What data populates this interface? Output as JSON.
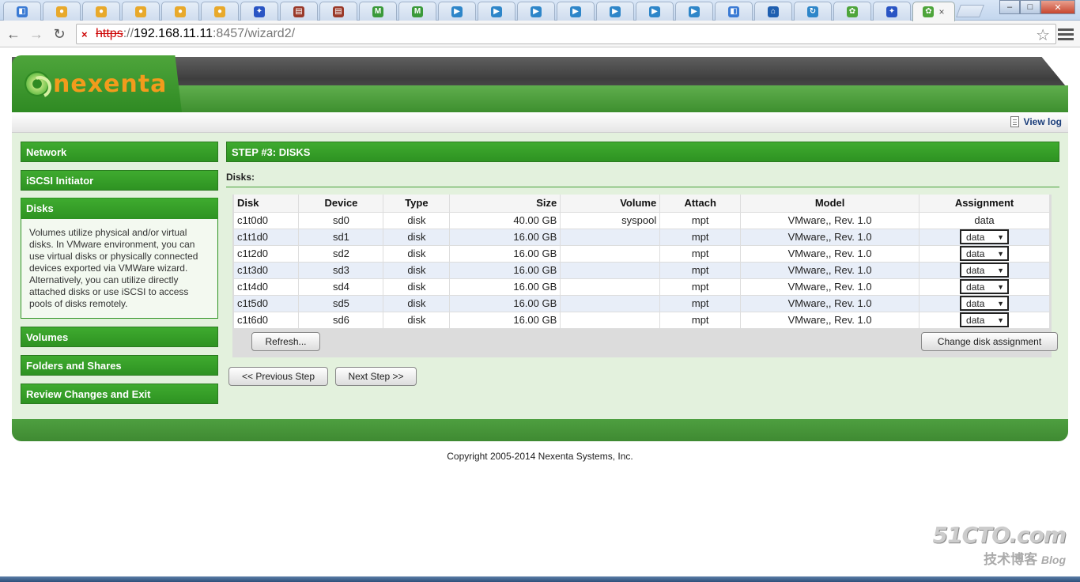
{
  "browser": {
    "tabs": [
      {
        "icon": "finder-icon",
        "color": "#3b7bd4",
        "glyph": "◧"
      },
      {
        "icon": "chat-bubble-icon",
        "color": "#e8a92b",
        "glyph": "●"
      },
      {
        "icon": "chat-bubble-icon",
        "color": "#e8a92b",
        "glyph": "●"
      },
      {
        "icon": "chat-bubble-icon",
        "color": "#e8a92b",
        "glyph": "●"
      },
      {
        "icon": "chat-bubble-icon",
        "color": "#e8a92b",
        "glyph": "●"
      },
      {
        "icon": "chat-bubble-icon",
        "color": "#e8a92b",
        "glyph": "●"
      },
      {
        "icon": "paw-icon",
        "color": "#2a55c4",
        "glyph": "✦"
      },
      {
        "icon": "notebook-icon",
        "color": "#9a3a2a",
        "glyph": "▤"
      },
      {
        "icon": "notebook-icon",
        "color": "#9a3a2a",
        "glyph": "▤"
      },
      {
        "icon": "mx-icon",
        "color": "#3a9a3a",
        "glyph": "M"
      },
      {
        "icon": "mx-icon",
        "color": "#3a9a3a",
        "glyph": "M"
      },
      {
        "icon": "play-circle-icon",
        "color": "#2e86c9",
        "glyph": "▶"
      },
      {
        "icon": "play-circle-icon",
        "color": "#2e86c9",
        "glyph": "▶"
      },
      {
        "icon": "play-circle-icon",
        "color": "#2e86c9",
        "glyph": "▶"
      },
      {
        "icon": "play-circle-icon",
        "color": "#2e86c9",
        "glyph": "▶"
      },
      {
        "icon": "play-circle-icon",
        "color": "#2e86c9",
        "glyph": "▶"
      },
      {
        "icon": "play-circle-icon",
        "color": "#2e86c9",
        "glyph": "▶"
      },
      {
        "icon": "play-circle-icon",
        "color": "#2e86c9",
        "glyph": "▶"
      },
      {
        "icon": "finder-icon",
        "color": "#3b7bd4",
        "glyph": "◧"
      },
      {
        "icon": "home-icon",
        "color": "#1f5fb0",
        "glyph": "⌂"
      },
      {
        "icon": "refresh-app-icon",
        "color": "#2e86c9",
        "glyph": "↻"
      },
      {
        "icon": "nexenta-icon",
        "color": "#4ea53b",
        "glyph": "✿"
      },
      {
        "icon": "paw-icon",
        "color": "#2a55c4",
        "glyph": "✦"
      }
    ],
    "active_tab": {
      "icon": "nexenta-icon",
      "color": "#4ea53b",
      "glyph": "✿",
      "close": "×"
    },
    "window": {
      "minimize": "–",
      "maximize": "□",
      "close": "✕"
    },
    "url": {
      "scheme": "https",
      "sep": "://",
      "host": "192.168.11.11",
      "rest": ":8457/wizard2/"
    }
  },
  "header": {
    "logo_text": "nexenta",
    "view_log": "View log"
  },
  "sidebar": {
    "items": [
      {
        "label": "Network"
      },
      {
        "label": "iSCSI Initiator"
      },
      {
        "label": "Disks"
      },
      {
        "label": "Volumes"
      },
      {
        "label": "Folders and Shares"
      },
      {
        "label": "Review Changes and Exit"
      }
    ],
    "disks_description": "Volumes utilize physical and/or virtual disks. In VMware environment, you can use virtual disks or physically connected devices exported via VMWare wizard. Alternatively, you can utilize directly attached disks or use iSCSI to access pools of disks remotely."
  },
  "main": {
    "step_title": "STEP #3: DISKS",
    "disks_label": "Disks:",
    "columns": [
      "Disk",
      "Device",
      "Type",
      "Size",
      "Volume",
      "Attach",
      "Model",
      "Assignment"
    ],
    "rows": [
      {
        "disk": "c1t0d0",
        "device": "sd0",
        "type": "disk",
        "size": "40.00 GB",
        "volume": "syspool",
        "attach": "mpt",
        "model": "VMware,, Rev. 1.0",
        "assignment": "data",
        "editable": false
      },
      {
        "disk": "c1t1d0",
        "device": "sd1",
        "type": "disk",
        "size": "16.00 GB",
        "volume": "",
        "attach": "mpt",
        "model": "VMware,, Rev. 1.0",
        "assignment": "data",
        "editable": true
      },
      {
        "disk": "c1t2d0",
        "device": "sd2",
        "type": "disk",
        "size": "16.00 GB",
        "volume": "",
        "attach": "mpt",
        "model": "VMware,, Rev. 1.0",
        "assignment": "data",
        "editable": true
      },
      {
        "disk": "c1t3d0",
        "device": "sd3",
        "type": "disk",
        "size": "16.00 GB",
        "volume": "",
        "attach": "mpt",
        "model": "VMware,, Rev. 1.0",
        "assignment": "data",
        "editable": true
      },
      {
        "disk": "c1t4d0",
        "device": "sd4",
        "type": "disk",
        "size": "16.00 GB",
        "volume": "",
        "attach": "mpt",
        "model": "VMware,, Rev. 1.0",
        "assignment": "data",
        "editable": true
      },
      {
        "disk": "c1t5d0",
        "device": "sd5",
        "type": "disk",
        "size": "16.00 GB",
        "volume": "",
        "attach": "mpt",
        "model": "VMware,, Rev. 1.0",
        "assignment": "data",
        "editable": true
      },
      {
        "disk": "c1t6d0",
        "device": "sd6",
        "type": "disk",
        "size": "16.00 GB",
        "volume": "",
        "attach": "mpt",
        "model": "VMware,, Rev. 1.0",
        "assignment": "data",
        "editable": true
      }
    ],
    "refresh_button": "Refresh...",
    "change_assignment_button": "Change disk assignment",
    "prev_button": "<< Previous Step",
    "next_button": "Next Step >>"
  },
  "footer": {
    "copyright": "Copyright 2005-2014 Nexenta Systems, Inc."
  },
  "watermark": {
    "line1": "51CTO.com",
    "line2": "技术博客",
    "line3": "Blog"
  },
  "colors": {
    "brand_green": "#2e9322",
    "logo_orange": "#f29b1c",
    "content_bg": "#e3f1dd"
  }
}
